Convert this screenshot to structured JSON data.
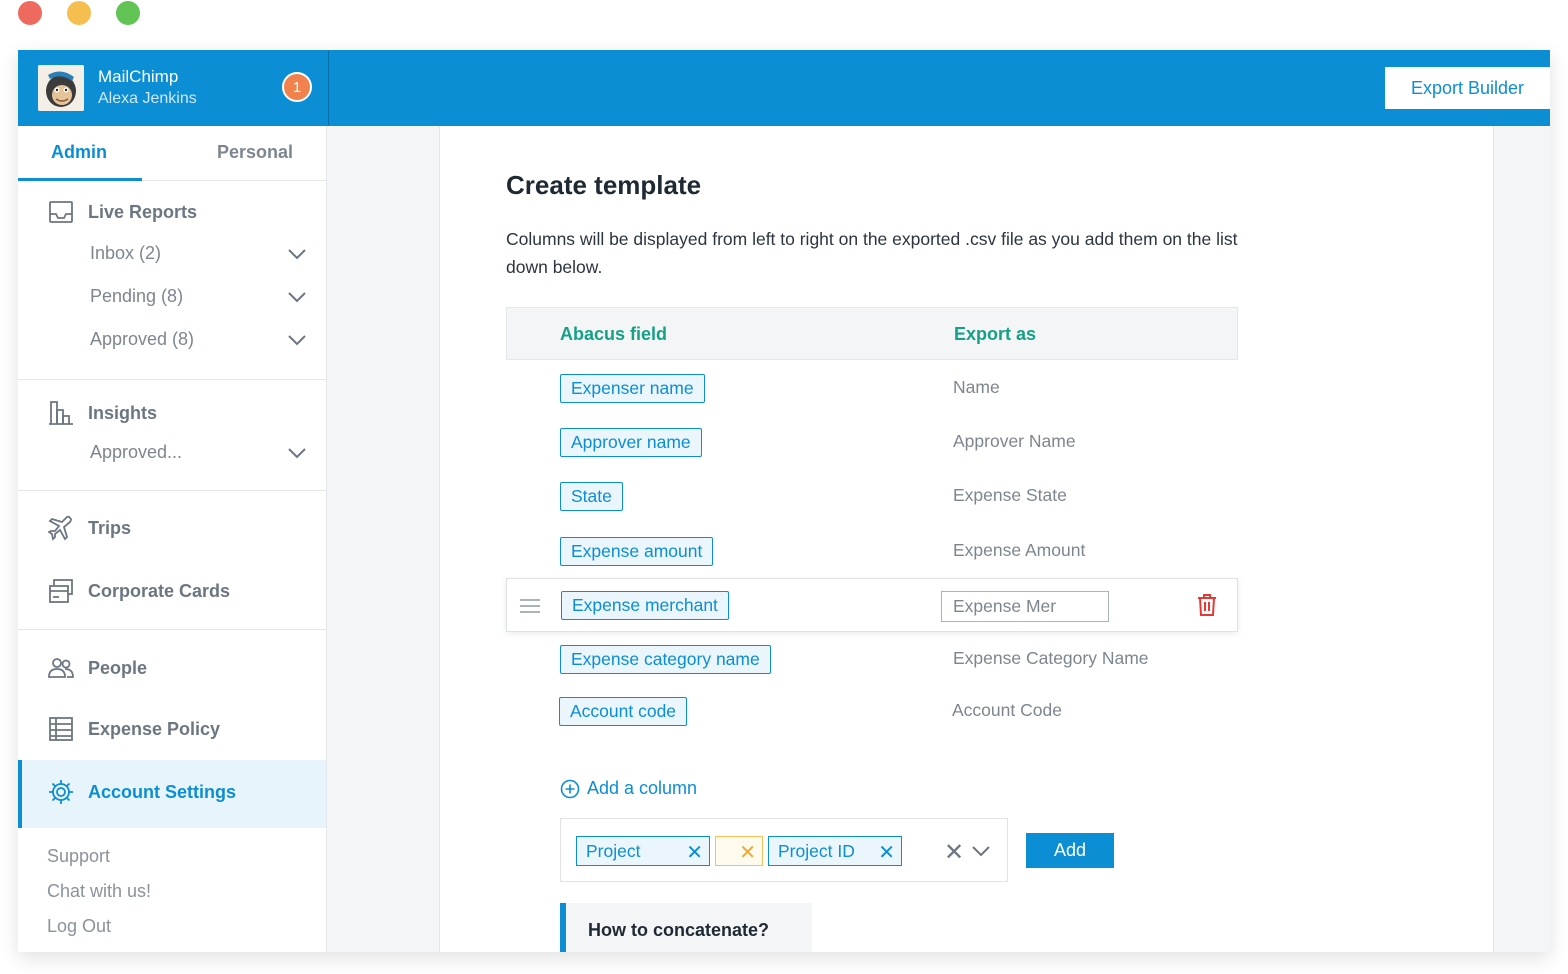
{
  "window": {
    "controls": {
      "close_color": "#ee6a5f",
      "minimize_color": "#f5be4f",
      "maximize_color": "#61c454"
    }
  },
  "colors": {
    "brand": "#0c8ed4",
    "accent_green": "#16a085",
    "badge": "#f2824d",
    "danger": "#e53935"
  },
  "header": {
    "org_name": "MailChimp",
    "user_name": "Alexa Jenkins",
    "notification_count": "1",
    "export_builder_label": "Export Builder"
  },
  "sidebar": {
    "tabs": [
      {
        "label": "Admin",
        "active": true
      },
      {
        "label": "Personal",
        "active": false
      }
    ],
    "live_reports": {
      "label": "Live Reports",
      "icon": "inbox-icon",
      "items": [
        {
          "label": "Inbox (2)"
        },
        {
          "label": "Pending (8)"
        },
        {
          "label": "Approved (8)"
        }
      ]
    },
    "insights": {
      "label": "Insights",
      "icon": "bar-chart-icon",
      "items": [
        {
          "label": "Approved..."
        }
      ]
    },
    "trips": {
      "label": "Trips",
      "icon": "airplane-icon"
    },
    "corporate_cards": {
      "label": "Corporate Cards",
      "icon": "cards-icon"
    },
    "people": {
      "label": "People",
      "icon": "people-icon"
    },
    "expense_policy": {
      "label": "Expense Policy",
      "icon": "policy-list-icon"
    },
    "account_settings": {
      "label": "Account Settings",
      "icon": "gear-icon",
      "active": true
    },
    "footer": [
      {
        "label": "Support"
      },
      {
        "label": "Chat with us!"
      },
      {
        "label": "Log Out"
      }
    ]
  },
  "main": {
    "title": "Create template",
    "description": "Columns will be displayed from left to right on the exported .csv file as you add them on the list down below.",
    "table": {
      "headers": {
        "field": "Abacus field",
        "export": "Export as"
      },
      "rows": [
        {
          "field": "Expenser name",
          "export": "Name"
        },
        {
          "field": "Approver name",
          "export": "Approver Name"
        },
        {
          "field": "State",
          "export": "Expense State"
        },
        {
          "field": "Expense amount",
          "export": "Expense Amount"
        },
        {
          "field": "Expense merchant",
          "export": "Expense Mer",
          "editing": true
        },
        {
          "field": "Expense category name",
          "export": "Expense Category Name"
        },
        {
          "field": "Account code",
          "export": "Account Code"
        }
      ]
    },
    "add_column_label": "Add a column",
    "concat": {
      "tags": [
        {
          "label": "Project"
        },
        {
          "label": ""
        },
        {
          "label": "Project ID"
        }
      ],
      "add_button_label": "Add"
    },
    "help_title": "How to concatenate?"
  }
}
